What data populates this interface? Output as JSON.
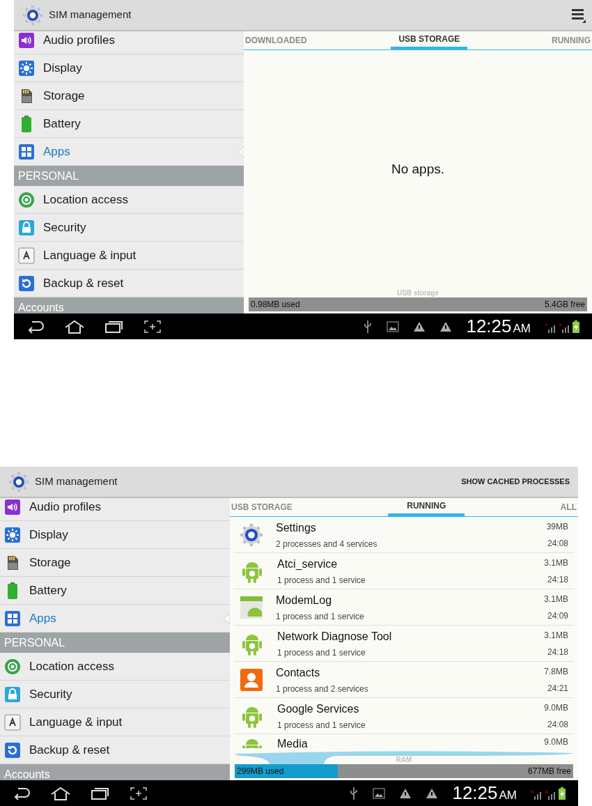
{
  "screens": [
    {
      "title": "SIM management",
      "action": {
        "kind": "menu"
      },
      "sidebar": [
        {
          "kind": "item",
          "label": "Audio profiles",
          "selected": false
        },
        {
          "kind": "item",
          "label": "Display",
          "selected": false
        },
        {
          "kind": "item",
          "label": "Storage",
          "selected": false
        },
        {
          "kind": "item",
          "label": "Battery",
          "selected": false
        },
        {
          "kind": "item",
          "label": "Apps",
          "selected": true
        },
        {
          "kind": "header",
          "label": "PERSONAL"
        },
        {
          "kind": "item",
          "label": "Location access",
          "selected": false
        },
        {
          "kind": "item",
          "label": "Security",
          "selected": false
        },
        {
          "kind": "item",
          "label": "Language & input",
          "selected": false
        },
        {
          "kind": "item",
          "label": "Backup & reset",
          "selected": false
        },
        {
          "kind": "header",
          "label": "Accounts"
        }
      ],
      "tabs": [
        {
          "label": "DOWNLOADED",
          "selected": false
        },
        {
          "label": "USB STORAGE",
          "selected": true
        },
        {
          "label": "RUNNING",
          "selected": false
        }
      ],
      "empty_message": "No apps.",
      "storage": {
        "kind": "usb",
        "label": "USB storage",
        "used": "0.98MB used",
        "free": "5.4GB free",
        "level": 0
      },
      "status_bar": {
        "time": "12:25",
        "ampm": "AM"
      }
    },
    {
      "title": "SIM management",
      "action": {
        "kind": "text",
        "label": "SHOW CACHED PROCESSES"
      },
      "sidebar": [
        {
          "kind": "item",
          "label": "Audio profiles",
          "selected": false
        },
        {
          "kind": "item",
          "label": "Display",
          "selected": false
        },
        {
          "kind": "item",
          "label": "Storage",
          "selected": false
        },
        {
          "kind": "item",
          "label": "Battery",
          "selected": false
        },
        {
          "kind": "item",
          "label": "Apps",
          "selected": true
        },
        {
          "kind": "header",
          "label": "PERSONAL"
        },
        {
          "kind": "item",
          "label": "Location access",
          "selected": false
        },
        {
          "kind": "item",
          "label": "Security",
          "selected": false
        },
        {
          "kind": "item",
          "label": "Language & input",
          "selected": false
        },
        {
          "kind": "item",
          "label": "Backup & reset",
          "selected": false
        },
        {
          "kind": "header",
          "label": "Accounts"
        }
      ],
      "tabs": [
        {
          "label": "USB STORAGE",
          "selected": false
        },
        {
          "label": "RUNNING",
          "selected": true
        },
        {
          "label": "ALL",
          "selected": false
        }
      ],
      "processes": [
        {
          "name": "Settings",
          "detail": "2 processes and 4 services",
          "size": "39MB",
          "time": "24:08"
        },
        {
          "name": "Atci_service",
          "detail": "1 process and 1 service",
          "size": "3.1MB",
          "time": "24:18"
        },
        {
          "name": "ModemLog",
          "detail": "1 process and 1 service",
          "size": "3.1MB",
          "time": "24:09"
        },
        {
          "name": "Network Diagnose Tool",
          "detail": "1 process and 1 service",
          "size": "3.1MB",
          "time": "24:18"
        },
        {
          "name": "Contacts",
          "detail": "1 process and 2 services",
          "size": "7.8MB",
          "time": "24:21"
        },
        {
          "name": "Google Services",
          "detail": "1 process and 1 service",
          "size": "9.0MB",
          "time": "24:08"
        },
        {
          "name": "Media",
          "size": "9.0MB"
        }
      ],
      "storage": {
        "kind": "ram",
        "label": "RAM",
        "used": "299MB used",
        "free": "677MB free",
        "level": 0.305
      },
      "status_bar": {
        "time": "12:25",
        "ampm": "AM"
      }
    }
  ]
}
